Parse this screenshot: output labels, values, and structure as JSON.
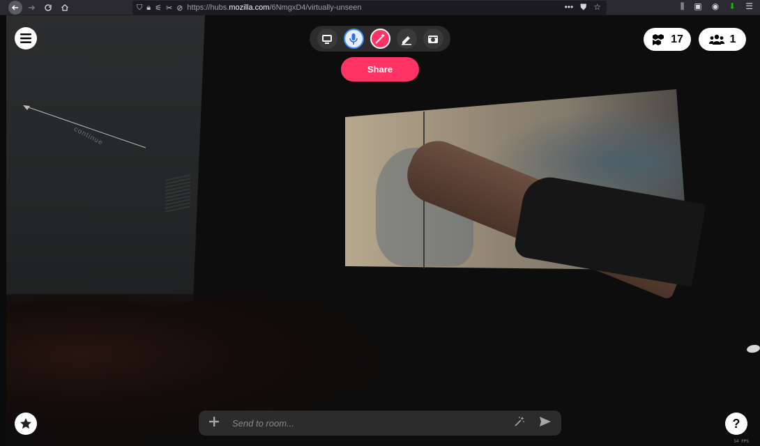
{
  "browser": {
    "url_prefix": "https://hubs.",
    "url_domain": "mozilla.com",
    "url_path": "/6NmgxD4/virtually-unseen",
    "icons": [
      "back-arrow-icon",
      "forward-arrow-icon",
      "reload-icon",
      "home-icon",
      "shield-icon",
      "lock-icon",
      "permissions-icon",
      "autoplay-blocked-icon",
      "camera-blocked-icon",
      "more-icon",
      "pocket-icon",
      "bookmark-star-icon",
      "library-icon",
      "sidebar-icon",
      "account-icon",
      "download-icon",
      "hamburger-menu-icon"
    ]
  },
  "scene": {
    "wall_arrow_label": "continue"
  },
  "top_tools": {
    "buttons": [
      "screen-share-icon",
      "microphone-icon",
      "magic-wand-icon",
      "pen-icon",
      "camera-icon"
    ]
  },
  "share_label": "Share",
  "objects_count": "17",
  "users_count": "1",
  "chat": {
    "placeholder": "Send to room..."
  },
  "fps_label": "54 FPS",
  "help_label": "?"
}
